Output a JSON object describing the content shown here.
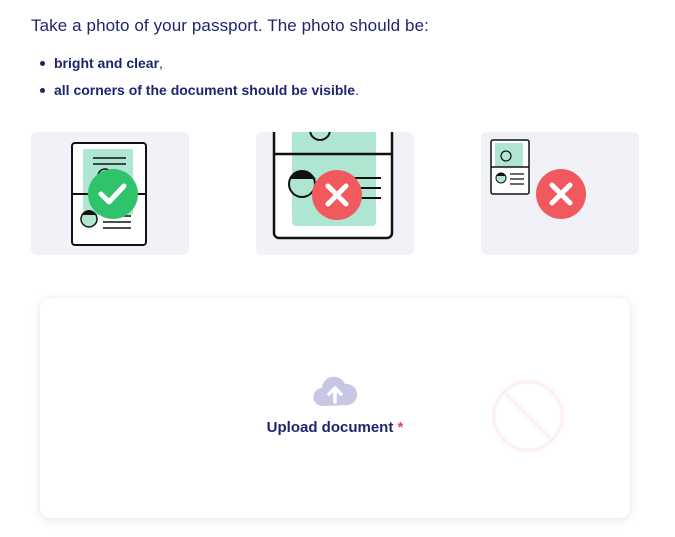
{
  "instructions": {
    "intro": "Take a photo of your passport. The photo should be:",
    "requirements": [
      {
        "text": "bright and clear",
        "suffix": ","
      },
      {
        "text": "all corners of the document should be visible",
        "suffix": "."
      }
    ]
  },
  "examples": [
    {
      "status": "correct",
      "icon": "checkmark-icon"
    },
    {
      "status": "incorrect",
      "icon": "cross-icon"
    },
    {
      "status": "incorrect",
      "icon": "cross-icon"
    }
  ],
  "upload": {
    "label": "Upload document",
    "required_mark": "*",
    "icon": "cloud-upload-icon"
  },
  "colors": {
    "text": "#1e2570",
    "success": "#2fc46b",
    "error": "#f05a5f",
    "card_bg": "#f1f2f8",
    "mint": "#aee6d1",
    "cloud": "#c5c7e3"
  }
}
